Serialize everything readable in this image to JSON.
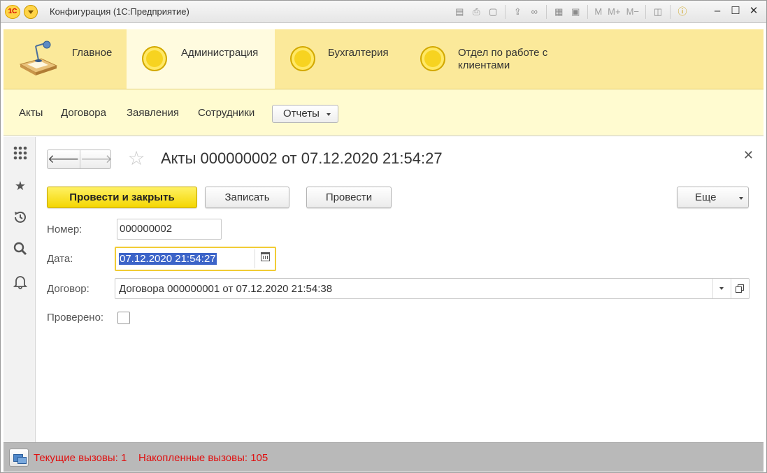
{
  "window": {
    "title": "Конфигурация (1С:Предприятие)",
    "logo_text": "1С"
  },
  "toolbar": {
    "memory_labels": [
      "M",
      "M+",
      "M−"
    ]
  },
  "sections": [
    {
      "label": "Главное"
    },
    {
      "label": "Администрация"
    },
    {
      "label": "Бухгалтерия"
    },
    {
      "label": "Отдел по работе с клиентами"
    }
  ],
  "function_panel": {
    "items": [
      "Акты",
      "Договора",
      "Заявления",
      "Сотрудники"
    ],
    "reports_label": "Отчеты"
  },
  "form": {
    "title": "Акты 000000002 от 07.12.2020 21:54:27",
    "buttons": {
      "post_and_close": "Провести и закрыть",
      "save": "Записать",
      "post": "Провести",
      "more": "Еще"
    },
    "fields": {
      "number_label": "Номер:",
      "number_value": "000000002",
      "date_label": "Дата:",
      "date_value": "07.12.2020 21:54:27",
      "contract_label": "Договор:",
      "contract_value": "Договора 000000001 от 07.12.2020 21:54:38",
      "checked_label": "Проверено:",
      "checked_value": false
    }
  },
  "status_bar": {
    "current_calls": "Текущие вызовы: 1",
    "accumulated_calls": "Накопленные вызовы: 105"
  },
  "colors": {
    "sections_bg": "#fbe99a",
    "function_panel_bg": "#fffbd0",
    "primary_button": "#f4d600",
    "status_text": "#e01010"
  }
}
